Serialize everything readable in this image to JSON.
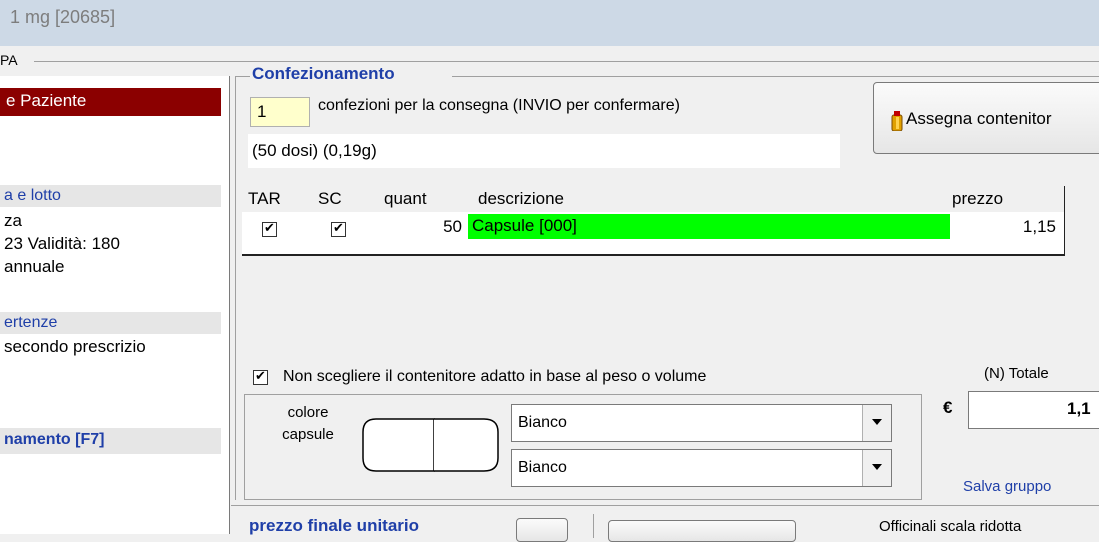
{
  "window": {
    "title": "1 mg  [20685]"
  },
  "group_label": "PA",
  "left_panel": {
    "row1": "e Paziente",
    "section_lotto": "a e lotto",
    "line_za": "za",
    "line_validita": "23 Validità: 180",
    "line_annuale": "annuale",
    "section_avvertenze": "ertenze",
    "line_secondo": " secondo prescrizio",
    "section_confezionamento": "namento [F7]"
  },
  "confezionamento": {
    "legend": "Confezionamento",
    "qty_value": "1",
    "qty_label": "confezioni per la consegna (INVIO per confermare)",
    "dose_info": "(50 dosi) (0,19g)",
    "assign_button": "Assegna contenitor"
  },
  "table": {
    "headers": {
      "tar": "TAR",
      "sc": "SC",
      "quant": "quant",
      "descrizione": "descrizione",
      "prezzo": "prezzo"
    },
    "row": {
      "quant": "50",
      "descrizione": "Capsule [000]",
      "prezzo": "1,15",
      "highlight": "#00ff00"
    }
  },
  "options": {
    "non_scegliere": "Non scegliere il contenitore adatto in base al peso o volume"
  },
  "totale": {
    "label": "(N) Totale",
    "currency": "€",
    "value": "1,1"
  },
  "colore": {
    "label_line1": "colore",
    "label_line2": "capsule",
    "select1": "Bianco",
    "select2": "Bianco"
  },
  "salva": "Salva gruppo",
  "bottom": {
    "prezzo_finale": "prezzo finale unitario",
    "officinali": "Officinali scala ridotta"
  },
  "colors": {
    "accent_blue": "#1f3fa8",
    "title_red": "#8b0000",
    "green": "#00ff00"
  }
}
